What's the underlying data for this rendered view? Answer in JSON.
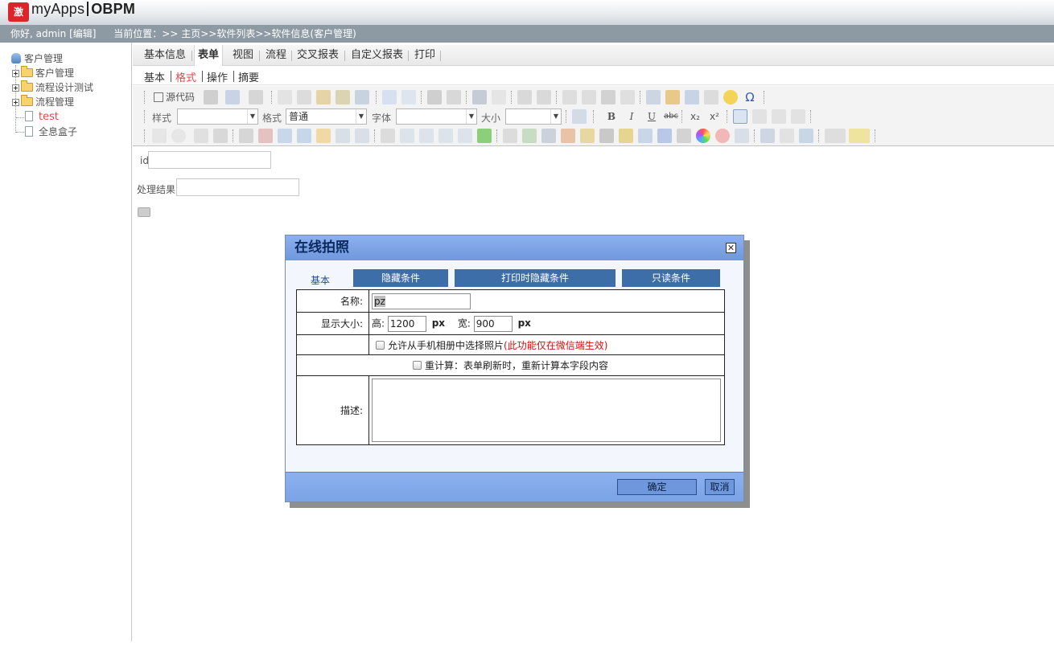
{
  "header": {
    "logo_badge": "激",
    "logo_app": "myApps",
    "logo_product": "OBPM"
  },
  "status": {
    "greeting": "你好, admin",
    "edit_link": "[编辑]",
    "location_label": "当前位置：",
    "breadcrumb": ">> 主页>>软件列表>>软件信息(客户管理)"
  },
  "sidebar": {
    "root": "客户管理",
    "items": [
      {
        "label": "客户管理",
        "type": "folder"
      },
      {
        "label": "流程设计测试",
        "type": "folder"
      },
      {
        "label": "流程管理",
        "type": "folder"
      },
      {
        "label": "test",
        "type": "page",
        "active": true
      },
      {
        "label": "全息盒子",
        "type": "page"
      }
    ]
  },
  "tabs": [
    "基本信息",
    "表单",
    "视图",
    "流程",
    "交叉报表",
    "自定义报表",
    "打印"
  ],
  "active_tab": "表单",
  "subtabs": [
    "基本",
    "格式",
    "操作",
    "摘要"
  ],
  "active_subtab": "格式",
  "toolbar": {
    "source_label": "源代码",
    "style_label": "样式",
    "format_label": "格式",
    "format_value": "普通",
    "font_label": "字体",
    "size_label": "大小",
    "bold": "B",
    "italic": "I",
    "underline": "U",
    "strike": "abc",
    "subscript": "x₂",
    "superscript": "x²",
    "omega": "Ω"
  },
  "form": {
    "field1_label": "id",
    "field2_label": "处理结果"
  },
  "dialog": {
    "title": "在线拍照",
    "close": "✕",
    "tab_basic": "基本",
    "tab_hidden": "隐藏条件",
    "tab_print_hidden": "打印时隐藏条件",
    "tab_readonly": "只读条件",
    "name_label": "名称:",
    "name_value": "pz",
    "size_label": "显示大小:",
    "height_label": "高:",
    "height_value": "1200",
    "px1": "px",
    "width_label": "宽:",
    "width_value": "900",
    "px2": "px",
    "allow_album": "允许从手机相册中选择照片",
    "allow_album_note": "(此功能仅在微信端生效)",
    "recalc": "重计算：表单刷新时，重新计算本字段内容",
    "desc_label": "描述:",
    "ok": "确定",
    "cancel": "取消"
  },
  "colors": {
    "accent_red": "#e0474c",
    "dialog_blue": "#6f97dd",
    "tab_btn_blue": "#3e6ea8",
    "status_gray": "#8e9aa3"
  }
}
